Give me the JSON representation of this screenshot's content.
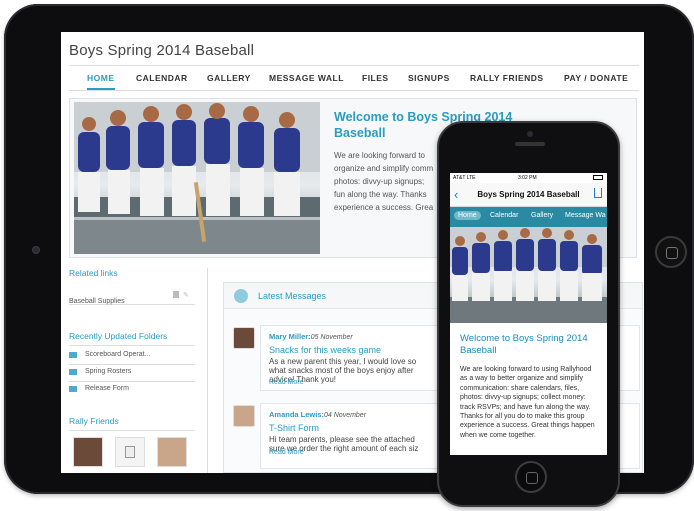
{
  "site": {
    "title": "Boys Spring 2014 Baseball",
    "nav": [
      "HOME",
      "CALENDAR",
      "GALLERY",
      "MESSAGE WALL",
      "FILES",
      "SIGNUPS",
      "RALLY FRIENDS",
      "PAY / DONATE"
    ]
  },
  "welcome": {
    "title": "Welcome to Boys Spring 2014 Baseball",
    "lines": [
      "We are looking forward to",
      "organize and simplify comm",
      "photos: divvy-up signups;",
      "fun along the way. Thanks",
      "experience a success. Grea"
    ]
  },
  "sidebar": {
    "related_links_heading": "Related links",
    "links": [
      "Baseball Supplies"
    ],
    "folders_heading": "Recently Updated Folders",
    "folders": [
      "Scoreboard Operat...",
      "Spring Rosters",
      "Release Form"
    ],
    "friends_heading": "Rally Friends"
  },
  "messages": {
    "heading": "Latest Messages",
    "items": [
      {
        "author": "Mary Miller:",
        "date": "05 November",
        "subject": "Snacks for this weeks game",
        "lines": [
          "As a new parent this year, I would love so",
          "what snacks most of the boys enjoy after",
          "advice! Thank you!"
        ],
        "read_more": "Read More"
      },
      {
        "author": "Amanda Lewis:",
        "date": "04 November",
        "subject": "T-Shirt Form",
        "lines": [
          "Hi team parents, please see the attached",
          "sure we order the right amount of each siz"
        ],
        "read_more": "Read More"
      }
    ]
  },
  "phone": {
    "status": {
      "carrier": "AT&T  LTE",
      "time": "3:02 PM"
    },
    "title": "Boys Spring 2014 Baseball",
    "tabs": [
      "Home",
      "Calendar",
      "Gallery",
      "Message Wa"
    ],
    "welcome": "Welcome to Boys Spring 2014 Baseball",
    "body": "We are looking forward to using Rallyhood as a way to better organize and simplify communication: share calendars, files, photos: divvy-up signups; collect money: track RSVPs; and have fun along the way. Thanks for all you do to make this group experience a success. Great things happen when we come together."
  },
  "colors": {
    "accent": "#2a9cc0",
    "phone_tabbar": "#2a8aa3",
    "link": "#1a7fd6"
  }
}
